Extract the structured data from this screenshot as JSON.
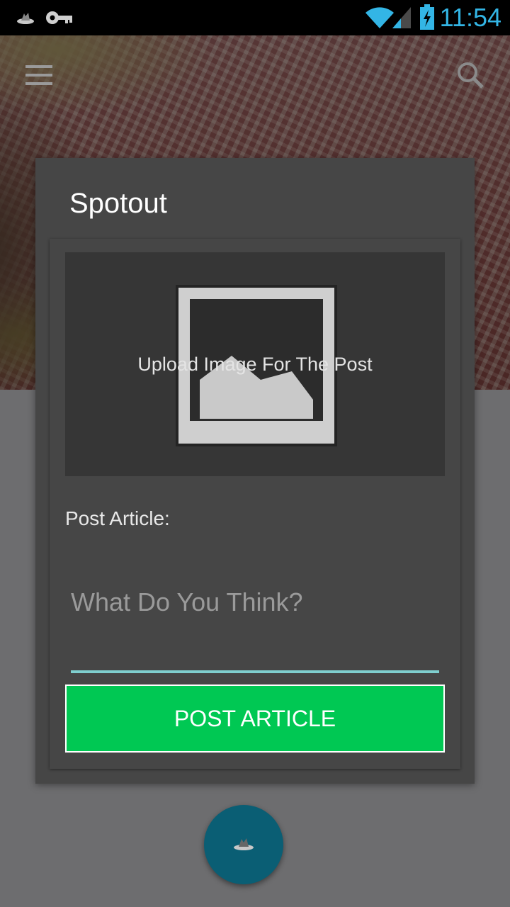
{
  "status_bar": {
    "time": "11:54",
    "left_icons": [
      "app-notification-icon",
      "key-icon"
    ],
    "right_icons": [
      "wifi-icon",
      "cell-signal-icon",
      "battery-charging-icon"
    ],
    "time_color": "#33b5e5"
  },
  "toolbar": {
    "menu_icon": "hamburger-menu-icon",
    "search_icon": "search-icon"
  },
  "dialog": {
    "title": "Spotout",
    "upload": {
      "label": "Upload Image For The Post",
      "icon": "image-placeholder-icon"
    },
    "post_article_label": "Post Article:",
    "input": {
      "value": "",
      "placeholder": "What Do You Think?",
      "underline_color": "#7fcfcf"
    },
    "button": {
      "label": "POST ARTICLE",
      "color": "#00c853"
    }
  },
  "fab": {
    "icon": "app-logo-icon",
    "color": "#0a5e74"
  }
}
